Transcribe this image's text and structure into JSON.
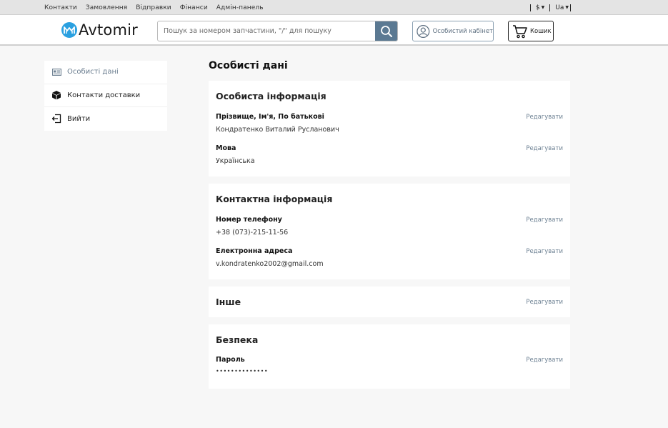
{
  "topbar": {
    "nav": [
      "Контакти",
      "Замовлення",
      "Відправки",
      "Фінанси",
      "Адмін-панель"
    ],
    "currency": "$",
    "language": "Ua"
  },
  "header": {
    "logo_text": "Avtomir",
    "search_placeholder": "Пошук за номером запчастини, \"/\" для пошуку",
    "cabinet_label": "Особистий кабінет",
    "cart_label": "Кошик"
  },
  "sidebar": {
    "items": [
      {
        "label": "Особисті дані",
        "icon": "id-card-icon",
        "active": true
      },
      {
        "label": "Контакти доставки",
        "icon": "box-icon",
        "active": false
      },
      {
        "label": "Вийти",
        "icon": "logout-icon",
        "active": false
      }
    ]
  },
  "main": {
    "page_title": "Особисті дані",
    "edit_label": "Редагувати",
    "personal": {
      "title": "Особиста інформація",
      "name_label": "Прізвище, Ім'я, По батькові",
      "name_value": "Кондратенко Виталий Русланович",
      "lang_label": "Мова",
      "lang_value": "Українська"
    },
    "contact": {
      "title": "Контактна інформація",
      "phone_label": "Номер телефону",
      "phone_value": "+38 (073)-215-11-56",
      "email_label": "Електронна адреса",
      "email_value": "v.kondratenko2002@gmail.com"
    },
    "other": {
      "title": "Інше"
    },
    "security": {
      "title": "Безпека",
      "password_label": "Пароль",
      "password_value": "••••••••••••••"
    }
  },
  "colors": {
    "accent": "#5b7992",
    "logo": "#2aa0e0",
    "link": "#6d8193"
  }
}
